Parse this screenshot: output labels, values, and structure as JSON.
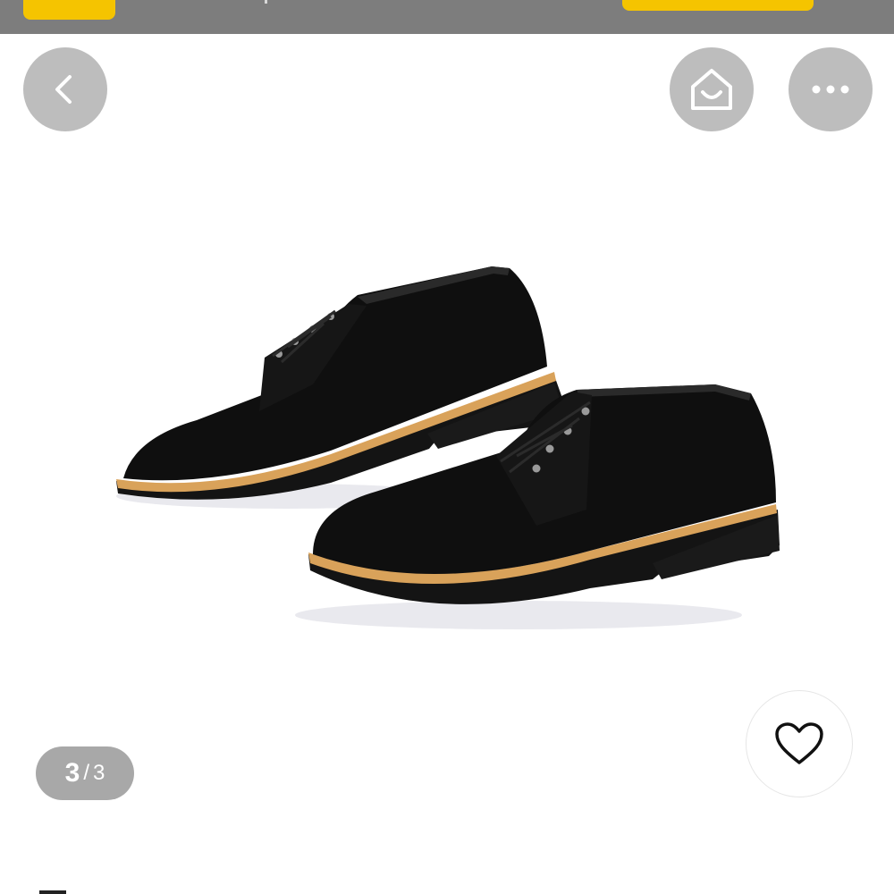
{
  "header": {
    "back_icon": "chevron-left-icon",
    "home_icon": "home-bag-icon",
    "more_icon": "more-dots-icon"
  },
  "gallery": {
    "current_index": "3",
    "separator": "/",
    "total": "3",
    "product_image_icon": "black-suede-derby-shoes"
  },
  "wishlist": {
    "icon": "heart-outline-icon"
  },
  "colors": {
    "banner": "#7d7d7d",
    "accent_yellow": "#f5c400",
    "circle_button": "#bdbdbd",
    "counter_bg": "#a8a8a8",
    "shoe_black": "#111111",
    "welt_tan": "#d9a25a"
  }
}
